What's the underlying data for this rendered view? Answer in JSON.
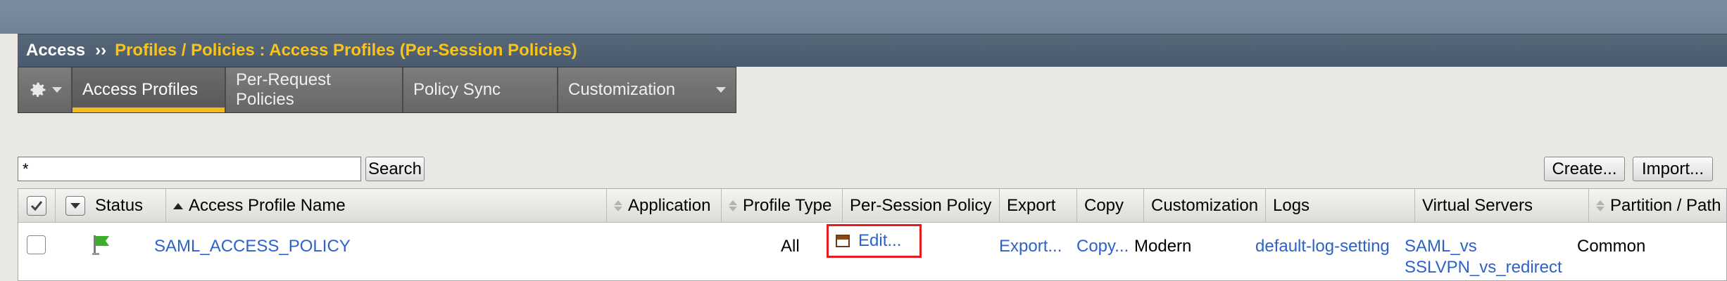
{
  "breadcrumb": {
    "root": "Access",
    "separator": "››",
    "current": "Profiles / Policies : Access Profiles (Per-Session Policies)"
  },
  "tabs": {
    "gear": "gear-icon",
    "items": [
      {
        "label": "Access Profiles",
        "active": true
      },
      {
        "label": "Per-Request Policies",
        "active": false
      },
      {
        "label": "Policy Sync",
        "active": false
      },
      {
        "label": "Customization",
        "active": false,
        "has_dropdown": true
      }
    ]
  },
  "filter": {
    "search_value": "*",
    "search_button": "Search",
    "create_button": "Create...",
    "import_button": "Import..."
  },
  "table": {
    "columns": [
      {
        "label": "Status"
      },
      {
        "label": "Access Profile Name",
        "sort": "ascending"
      },
      {
        "label": "Application",
        "sort": "sortable"
      },
      {
        "label": "Profile Type",
        "sort": "sortable"
      },
      {
        "label": "Per-Session Policy"
      },
      {
        "label": "Export"
      },
      {
        "label": "Copy"
      },
      {
        "label": "Customization"
      },
      {
        "label": "Logs"
      },
      {
        "label": "Virtual Servers"
      },
      {
        "label": "Partition / Path",
        "sort": "sortable"
      }
    ],
    "rows": [
      {
        "status": "green-flag-icon",
        "name": "SAML_ACCESS_POLICY",
        "application": "",
        "profile_type": "All",
        "per_session_policy": "Edit...",
        "export": "Export...",
        "copy": "Copy...",
        "customization": "Modern",
        "logs": "default-log-setting",
        "virtual_servers": [
          "SAML_vs",
          "SSLVPN_vs_redirect"
        ],
        "partition": "Common"
      }
    ]
  },
  "colors": {
    "accent": "#f8c31a",
    "link": "#2d62c8",
    "highlight_box": "#e31b23",
    "status_flag": "#3cae2b"
  }
}
